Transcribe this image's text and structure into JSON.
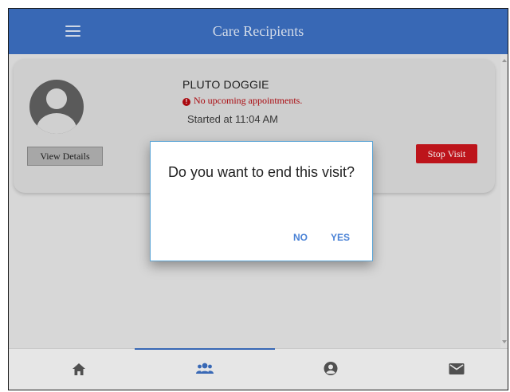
{
  "header": {
    "title": "Care Recipients",
    "menu_icon": "hamburger-icon"
  },
  "card": {
    "name": "PLUTO DOGGIE",
    "alert_text": "No upcoming appointments.",
    "started_text": "Started at 11:04 AM",
    "view_details_label": "View Details",
    "stop_visit_label": "Stop Visit"
  },
  "dialog": {
    "message": "Do you want to end this visit?",
    "no_label": "NO",
    "yes_label": "YES"
  },
  "nav": {
    "tabs": [
      {
        "icon": "home-icon"
      },
      {
        "icon": "users-icon",
        "active": true
      },
      {
        "icon": "user-circle-icon"
      },
      {
        "icon": "envelope-icon"
      }
    ]
  },
  "colors": {
    "primary": "#3c6ebf",
    "danger": "#c8161d",
    "dialog_action": "#4a82d6"
  }
}
